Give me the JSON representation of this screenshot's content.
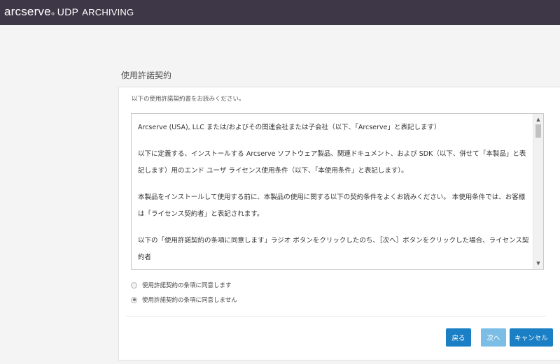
{
  "header": {
    "brand_logo": "arcserve",
    "brand_reg": "®",
    "product": "UDP",
    "product_sub": "ARCHIVING"
  },
  "page": {
    "title": "使用許諾契約"
  },
  "panel": {
    "instruction": "以下の使用許諾契約書をお読みください。",
    "eula_paragraphs": [
      "Arcserve (USA), LLC または/およびその関連会社または子会社（以下、「Arcserve」と表記します）",
      "以下に定義する、インストールする Arcserve ソフトウェア製品、関連ドキュメント、および SDK（以下、併せて「本製品」と表記します）用のエンド ユーザ ライセンス使用条件（以下、「本使用条件」と表記します）。",
      "本製品をインストールして使用する前に、本製品の使用に関する以下の契約条件をよくお読みください。 本使用条件では、お客様は「ライセンス契約者」と表記されます。",
      "以下の「使用許諾契約の条項に同意します」ラジオ ボタンをクリックしたのち、［次へ］ボタンをクリックした場合、ライセンス契約者"
    ],
    "scroll_up_icon": "▲",
    "scroll_down_icon": "▼",
    "radio_accept_label": "使用許諾契約の条項に同意します",
    "radio_decline_label": "使用許諾契約の条項に同意しません",
    "selected_option": "decline"
  },
  "buttons": {
    "back": "戻る",
    "next": "次へ",
    "cancel": "キャンセル"
  },
  "colors": {
    "topbar": "#3e3747",
    "primary_button": "#1a7fc4",
    "disabled_button": "#7cbde6"
  }
}
